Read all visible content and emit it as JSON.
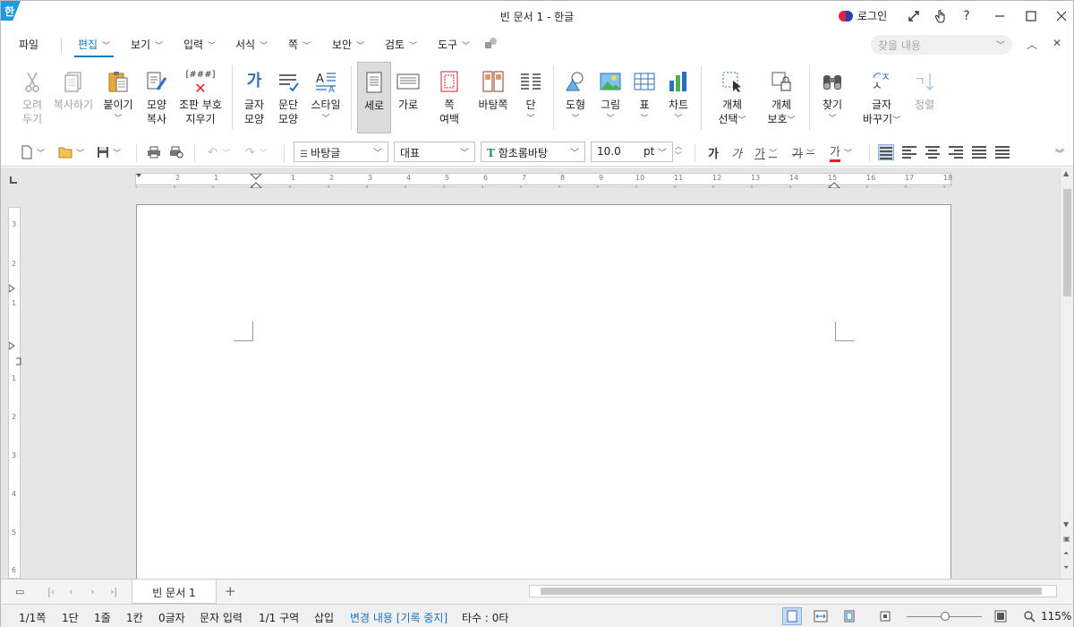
{
  "window": {
    "title": "빈 문서 1 - 한글",
    "logo": "한",
    "login_label": "로그인"
  },
  "menu": {
    "file": "파일",
    "tabs": [
      "편집",
      "보기",
      "입력",
      "서식",
      "쪽",
      "보안",
      "검토",
      "도구"
    ],
    "active_tab": "편집",
    "search_placeholder": "찾을 내용"
  },
  "ribbon": {
    "cut": [
      "오려",
      "두기"
    ],
    "copy": "복사하기",
    "paste": "붙이기",
    "shape_copy": [
      "모양",
      "복사"
    ],
    "clear": [
      "조판 부호",
      "지우기"
    ],
    "char_shape": [
      "글자",
      "모양"
    ],
    "para_shape": [
      "문단",
      "모양"
    ],
    "style": "스타일",
    "portrait": "세로",
    "landscape": "가로",
    "page_margin": [
      "쪽",
      "여백"
    ],
    "background": "바탕쪽",
    "columns": "단",
    "shape": "도형",
    "picture": "그림",
    "table": "표",
    "chart": "차트",
    "obj_select": [
      "개체",
      "선택"
    ],
    "obj_protect": [
      "개체",
      "보호"
    ],
    "find": "찾기",
    "replace": [
      "글자",
      "바꾸기"
    ],
    "sort": "정렬",
    "clear_icon_text": "[###]",
    "char_icon_text": "가"
  },
  "format": {
    "style": "바탕글",
    "lang": "대표",
    "font": "함초롬바탕",
    "font_icon": "T",
    "size": "10.0",
    "unit": "pt",
    "char_buttons": [
      "가",
      "가",
      "가",
      "가",
      "가"
    ]
  },
  "ruler": {
    "h_numbers": [
      "2",
      "1",
      "1",
      "2",
      "3",
      "4",
      "5",
      "6",
      "7",
      "8",
      "9",
      "10",
      "11",
      "12",
      "13",
      "14",
      "15",
      "16",
      "17",
      "18"
    ],
    "v_numbers": [
      "3",
      "2",
      "1",
      "1",
      "2",
      "3",
      "4",
      "5",
      "6"
    ]
  },
  "tabs": {
    "doc_tab": "빈 문서 1",
    "add": "+"
  },
  "status": {
    "page": "1/1쪽",
    "column": "1단",
    "line": "1줄",
    "col": "1칸",
    "chars": "0글자",
    "input_mode": "문자 입력",
    "section": "1/1 구역",
    "insert": "삽입",
    "track": "변경 내용 [기록 중지]",
    "typing": "타수 : 0타",
    "zoom": "115%"
  },
  "colors": {
    "accent": "#1877c4",
    "logo": "#1e9be0"
  }
}
